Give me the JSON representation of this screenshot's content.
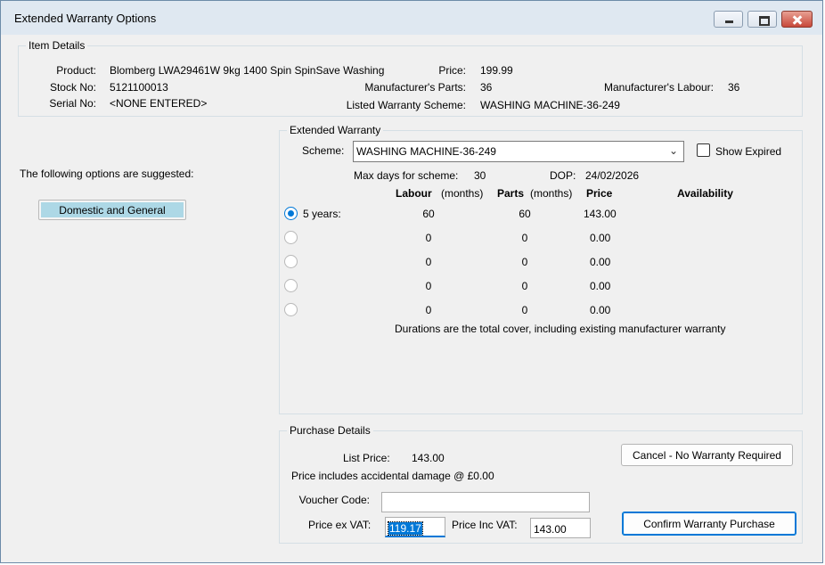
{
  "window": {
    "title": "Extended Warranty Options",
    "controls": {
      "minimize_icon": "minimize-icon",
      "maximize_icon": "maximize-icon",
      "close_icon": "close-icon"
    }
  },
  "item_details": {
    "legend": "Item Details",
    "product_label": "Product:",
    "product_value": "Blomberg LWA29461W 9kg 1400 Spin SpinSave Washing",
    "stock_label": "Stock No:",
    "stock_value": "5121100013",
    "serial_label": "Serial No:",
    "serial_value": "<NONE ENTERED>",
    "price_label": "Price:",
    "price_value": "199.99",
    "mfr_parts_label": "Manufacturer's Parts:",
    "mfr_parts_value": "36",
    "listed_scheme_label": "Listed Warranty Scheme:",
    "listed_scheme_value": "WASHING MACHINE-36-249",
    "mfr_labour_label": "Manufacturer's Labour:",
    "mfr_labour_value": "36"
  },
  "suggestions": {
    "text": "The following options are suggested:",
    "provider_button": "Domestic and General"
  },
  "extended_warranty": {
    "legend": "Extended Warranty",
    "scheme_label": "Scheme:",
    "scheme_value": "WASHING MACHINE-36-249",
    "show_expired_label": "Show Expired",
    "show_expired_checked": false,
    "max_days_label": "Max days for scheme:",
    "max_days_value": "30",
    "dop_label": "DOP:",
    "dop_value": "24/02/2026",
    "headers": {
      "labour": "Labour",
      "labour_unit": "(months)",
      "parts": "Parts",
      "parts_unit": "(months)",
      "price": "Price",
      "availability": "Availability"
    },
    "options": [
      {
        "selected": true,
        "label": "5 years:",
        "labour": "60",
        "parts": "60",
        "price": "143.00"
      },
      {
        "selected": false,
        "label": "",
        "labour": "0",
        "parts": "0",
        "price": "0.00"
      },
      {
        "selected": false,
        "label": "",
        "labour": "0",
        "parts": "0",
        "price": "0.00"
      },
      {
        "selected": false,
        "label": "",
        "labour": "0",
        "parts": "0",
        "price": "0.00"
      },
      {
        "selected": false,
        "label": "",
        "labour": "0",
        "parts": "0",
        "price": "0.00"
      }
    ],
    "note": "Durations are the total cover, including existing manufacturer warranty"
  },
  "purchase": {
    "legend": "Purchase Details",
    "list_price_label": "List Price:",
    "list_price_value": "143.00",
    "accidental_text": "Price includes accidental damage @ £0.00",
    "voucher_label": "Voucher Code:",
    "voucher_value": "",
    "price_ex_vat_label": "Price ex VAT:",
    "price_ex_vat_value": "119.17",
    "price_inc_vat_label": "Price Inc VAT:",
    "price_inc_vat_value": "143.00",
    "cancel_button": "Cancel - No Warranty Required",
    "confirm_button": "Confirm Warranty Purchase"
  },
  "colors": {
    "accent": "#0078d7",
    "provider_highlight": "#add8e6",
    "close_button": "#c7483a"
  }
}
